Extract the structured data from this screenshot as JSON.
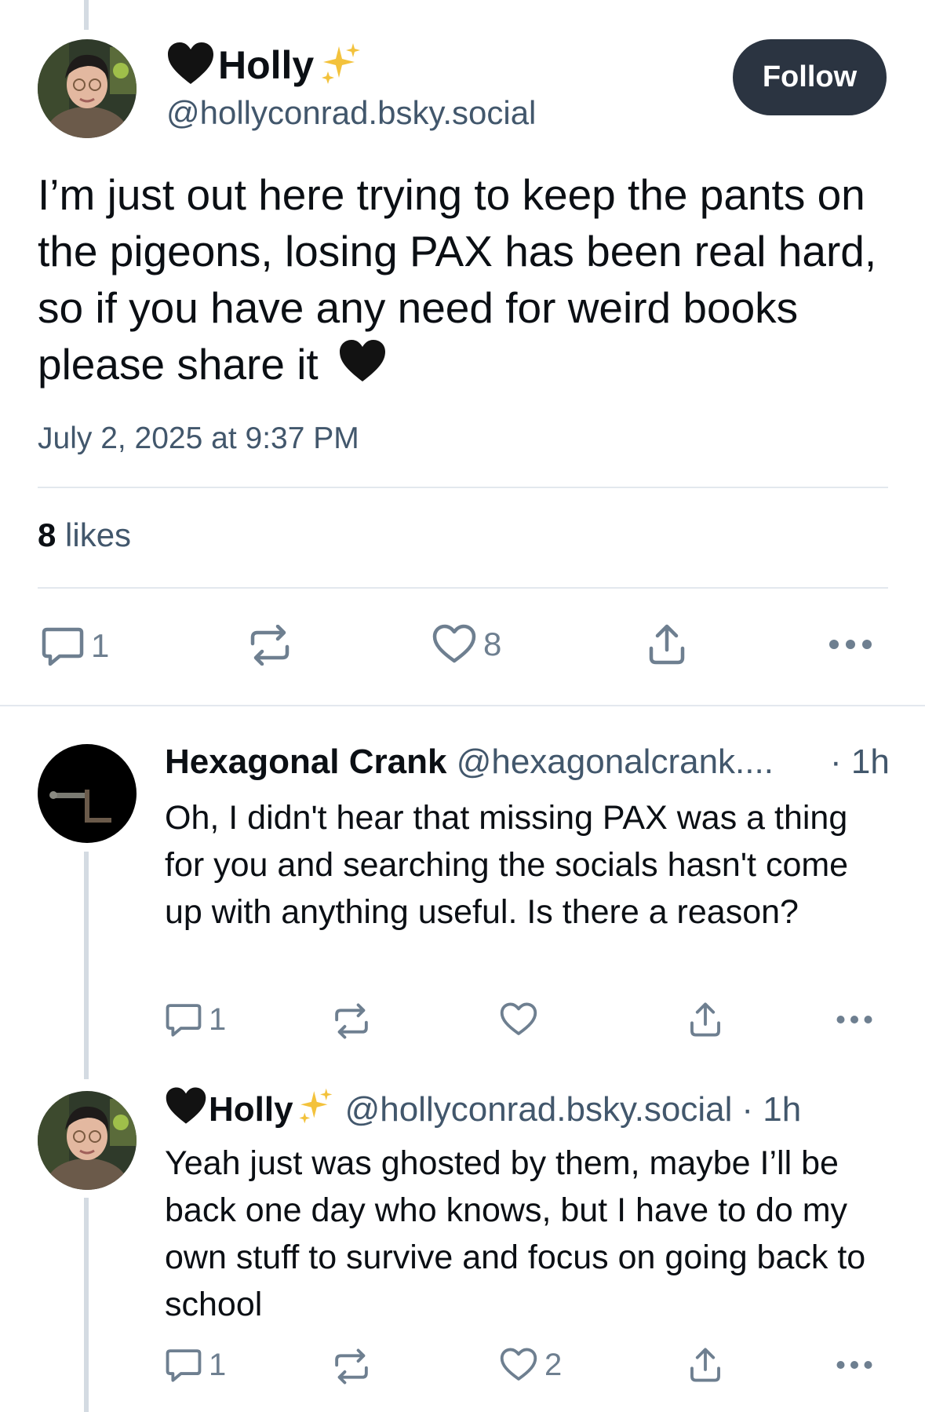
{
  "main_post": {
    "author_name": "Holly",
    "handle": "@hollyconrad.bsky.social",
    "follow_label": "Follow",
    "text": "I’m just out here trying to keep the pants on the pigeons, losing PAX has been real hard, so if you have any need for weird books please share it",
    "timestamp": "July 2, 2025 at 9:37 PM",
    "likes_count": "8",
    "likes_label": "likes",
    "reply_count": "1",
    "like_count": "8"
  },
  "replies": [
    {
      "author_name": "Hexagonal Crank",
      "handle": "@hexagonalcrank....",
      "time": "· 1h",
      "text": "Oh, I didn't hear that missing PAX was a thing for you and searching the socials hasn't come up with anything useful. Is there a reason?",
      "reply_count": "1",
      "like_count": ""
    },
    {
      "author_name": "Holly",
      "handle": "@hollyconrad.bsky.social",
      "time": "· 1h",
      "text": "Yeah just was ghosted by them, maybe I’ll be back one day who knows, but I have to do my own stuff to survive and focus on going back to school",
      "reply_count": "1",
      "like_count": "2"
    }
  ],
  "icons": {
    "emoji_black_heart": "black-heart-icon",
    "emoji_sparkles": "sparkles-icon",
    "reply": "reply-icon",
    "repost": "repost-icon",
    "like": "heart-icon",
    "share": "share-icon",
    "more": "more-icon"
  },
  "colors": {
    "follow_bg": "#2b3441",
    "secondary_text": "#42576c",
    "icon_gray": "#6e7f90",
    "divider": "#e3e8ee",
    "thread_line": "#d4dbe2"
  }
}
